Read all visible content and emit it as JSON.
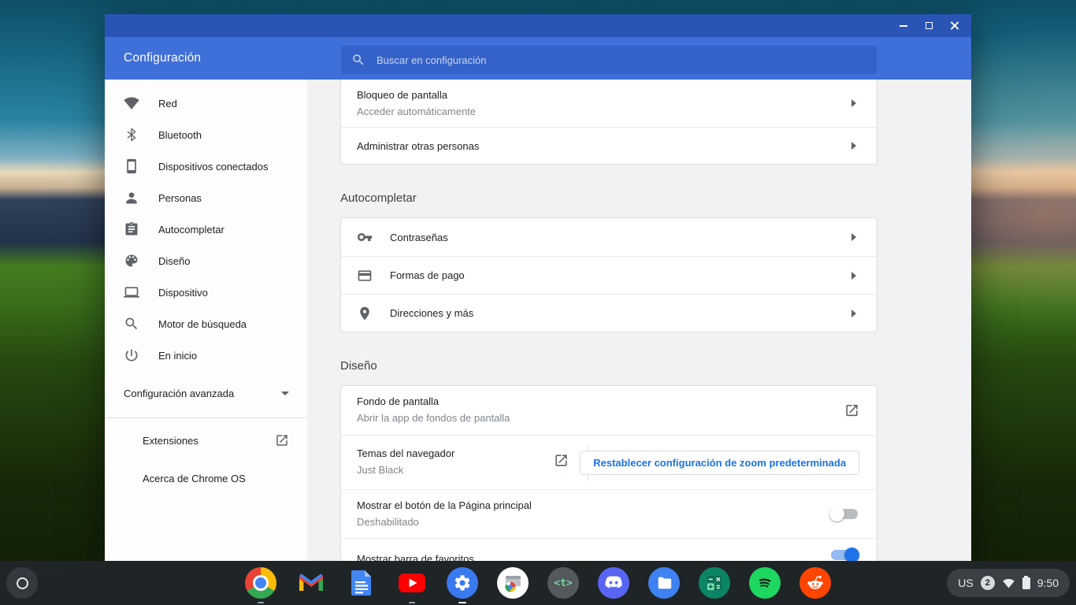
{
  "titlebar": {
    "controls": [
      "minimize",
      "maximize",
      "close"
    ]
  },
  "header": {
    "title": "Configuración",
    "search": {
      "placeholder": "Buscar en configuración",
      "icon": "search-icon"
    }
  },
  "sidebar": {
    "items": [
      {
        "icon": "wifi-icon",
        "label": "Red"
      },
      {
        "icon": "bluetooth-icon",
        "label": "Bluetooth"
      },
      {
        "icon": "smartphone-icon",
        "label": "Dispositivos conectados"
      },
      {
        "icon": "person-icon",
        "label": "Personas"
      },
      {
        "icon": "assignment-icon",
        "label": "Autocompletar"
      },
      {
        "icon": "palette-icon",
        "label": "Diseño"
      },
      {
        "icon": "laptop-icon",
        "label": "Dispositivo"
      },
      {
        "icon": "search-icon",
        "label": "Motor de búsqueda"
      },
      {
        "icon": "power-icon",
        "label": "En inicio"
      }
    ],
    "advanced_label": "Configuración avanzada",
    "extensions_label": "Extensiones",
    "about_label": "Acerca de Chrome OS"
  },
  "people_card": {
    "rows": [
      {
        "title": "Bloqueo de pantalla",
        "subtitle": "Acceder automáticamente"
      },
      {
        "title": "Administrar otras personas"
      }
    ]
  },
  "autofill": {
    "section_title": "Autocompletar",
    "rows": [
      {
        "icon": "key-icon",
        "label": "Contraseñas"
      },
      {
        "icon": "credit-card-icon",
        "label": "Formas de pago"
      },
      {
        "icon": "location-icon",
        "label": "Direcciones y más"
      }
    ]
  },
  "appearance": {
    "section_title": "Diseño",
    "wallpaper_row": {
      "title": "Fondo de pantalla",
      "subtitle": "Abrir la app de fondos de pantalla"
    },
    "themes_row": {
      "title": "Temas del navegador",
      "subtitle": "Just Black",
      "reset_button": "Restablecer configuración de zoom predeterminada"
    },
    "home_button_row": {
      "title": "Mostrar el botón de la Página principal",
      "subtitle": "Deshabilitado",
      "enabled": false
    },
    "bookmarks_row": {
      "title": "Mostrar barra de favoritos",
      "enabled": true
    }
  },
  "shelf": {
    "apps": [
      "chrome",
      "gmail",
      "docs",
      "youtube",
      "settings",
      "chrome-web-app",
      "text",
      "discord",
      "files",
      "calculator",
      "spotify",
      "reddit"
    ],
    "text_app_glyph": "<t>",
    "status": {
      "keyboard_layout": "US",
      "notification_count": "2",
      "time": "9:50"
    }
  },
  "colors": {
    "titlebar": "#2a54b6",
    "header": "#3f6fd8",
    "search_field": "#3562c8",
    "accent_blue": "#1a73e8",
    "toggle_on": "#1e74e8",
    "shelf": "#212529"
  }
}
